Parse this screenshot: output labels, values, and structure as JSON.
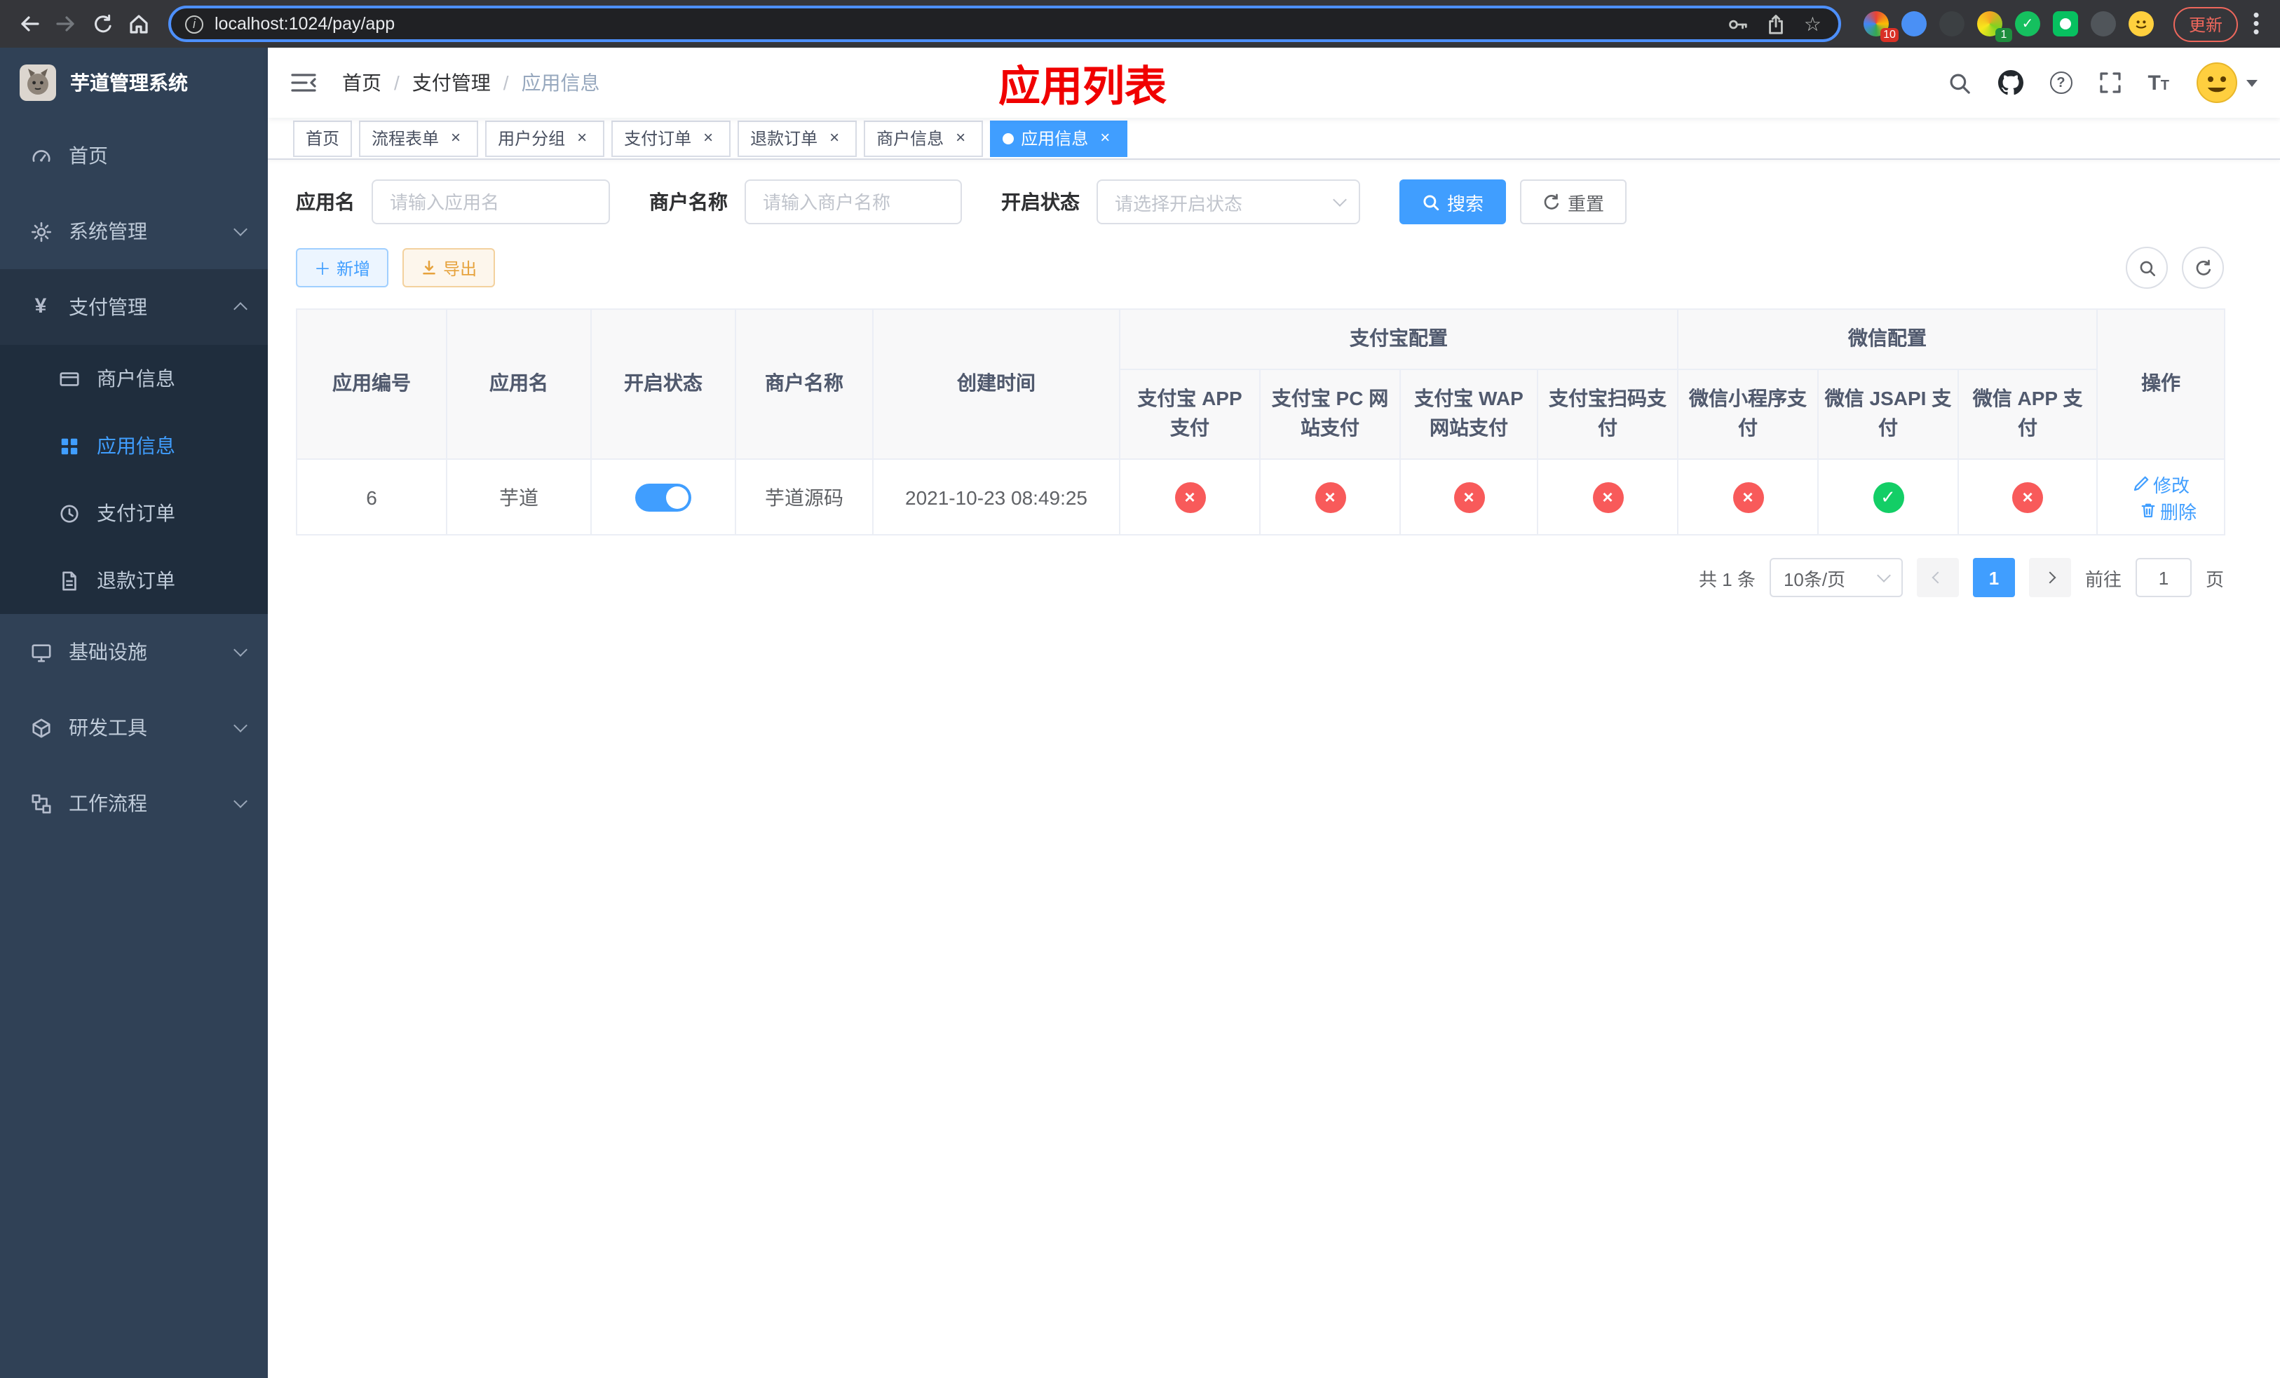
{
  "colors": {
    "primary": "#409eff",
    "success_green": "#13ce66",
    "danger_red": "#f85a5a",
    "warning_orange": "#e6a23c",
    "page_title_red": "#f00000",
    "sidebar_bg": "#304156",
    "submenu_bg": "#1f2d3d",
    "chrome_bg": "#35363a",
    "omnibox_focus_blue": "#4d90fe"
  },
  "browser": {
    "url": "localhost:1024/pay/app",
    "update_label": "更新",
    "ext_badge_a": "10",
    "ext_badge_b": "1"
  },
  "sidebar": {
    "app_title": "芋道管理系统",
    "items": {
      "home": "首页",
      "system": "系统管理",
      "payment": "支付管理",
      "infra": "基础设施",
      "devtools": "研发工具",
      "workflow": "工作流程"
    },
    "payment_children": {
      "merchant": "商户信息",
      "app": "应用信息",
      "order": "支付订单",
      "refund": "退款订单"
    }
  },
  "breadcrumb": {
    "home": "首页",
    "payment": "支付管理",
    "current": "应用信息"
  },
  "page_title": "应用列表",
  "tabs": [
    {
      "label": "首页"
    },
    {
      "label": "流程表单"
    },
    {
      "label": "用户分组"
    },
    {
      "label": "支付订单"
    },
    {
      "label": "退款订单"
    },
    {
      "label": "商户信息"
    },
    {
      "label": "应用信息"
    }
  ],
  "filters": {
    "app_name_label": "应用名",
    "app_name_placeholder": "请输入应用名",
    "merchant_label": "商户名称",
    "merchant_placeholder": "请输入商户名称",
    "status_label": "开启状态",
    "status_placeholder": "请选择开启状态",
    "search_button": "搜索",
    "reset_button": "重置"
  },
  "toolbar": {
    "add_button": "新增",
    "export_button": "导出"
  },
  "table": {
    "headers": {
      "app_id": "应用编号",
      "app_name": "应用名",
      "status": "开启状态",
      "merchant": "商户名称",
      "created": "创建时间",
      "alipay_group": "支付宝配置",
      "wechat_group": "微信配置",
      "alipay_app": "支付宝 APP 支付",
      "alipay_pc": "支付宝 PC 网站支付",
      "alipay_wap": "支付宝 WAP 网站支付",
      "alipay_scan": "支付宝扫码支付",
      "wechat_lite": "微信小程序支付",
      "wechat_jsapi": "微信 JSAPI 支付",
      "wechat_app": "微信 APP 支付",
      "actions": "操作"
    },
    "rows": [
      {
        "app_id": "6",
        "app_name": "芋道",
        "enabled": true,
        "merchant": "芋道源码",
        "created": "2021-10-23 08:49:25",
        "statuses": [
          false,
          false,
          false,
          false,
          false,
          true,
          false
        ],
        "edit": "修改",
        "delete": "删除"
      }
    ]
  },
  "pagination": {
    "total": "共 1 条",
    "page_size": "10条/页",
    "page": "1",
    "goto_label": "前往",
    "goto_value": "1",
    "goto_unit": "页"
  }
}
